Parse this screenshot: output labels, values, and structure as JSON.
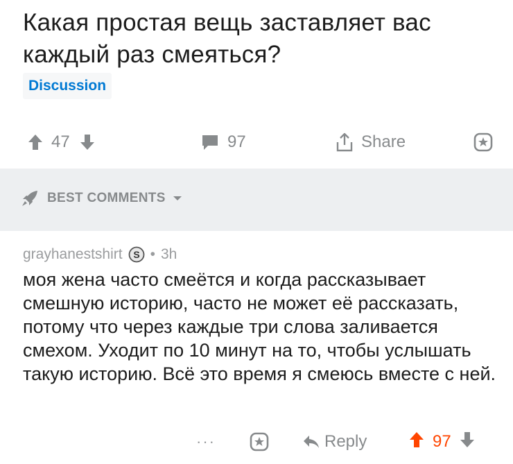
{
  "post": {
    "title": "Какая простая вещь заставляет вас каждый раз смеяться?",
    "flair": "Discussion",
    "flair_color": "#0079d3"
  },
  "actions": {
    "upvote_icon": "arrow-up-icon",
    "score": "47",
    "downvote_icon": "arrow-down-icon",
    "comments_icon": "comment-bubble-icon",
    "comment_count": "97",
    "share_icon": "share-icon",
    "share_label": "Share",
    "save_icon": "star-icon"
  },
  "best_comments": {
    "icon": "rocket-icon",
    "label": "BEST COMMENTS",
    "caret_icon": "caret-down-icon",
    "background": "#edeff1"
  },
  "comment": {
    "author": "grayhanestshirt",
    "badge_icon": "silver-s-badge-icon",
    "separator": "•",
    "age": "3h",
    "body": "моя жена часто смеётся и когда рассказывает смешную историю, часто не может её рассказать, потому что через каждые три слова заливается смехом. Уходит по 10 минут на то, чтобы услышать такую историю. Всё это время я смеюсь вместе с ней.",
    "more_label": "···",
    "save_icon": "star-icon",
    "reply_icon": "reply-arrow-icon",
    "reply_label": "Reply",
    "score": "97",
    "upvoted_color": "#ff4500"
  }
}
